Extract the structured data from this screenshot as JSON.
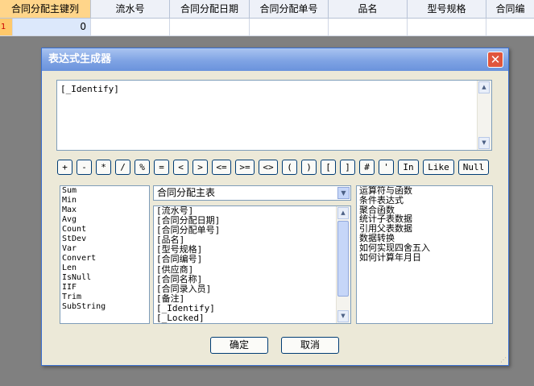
{
  "grid": {
    "headers": [
      "合同分配主键列",
      "流水号",
      "合同分配日期",
      "合同分配单号",
      "品名",
      "型号规格",
      "合同编"
    ],
    "row_marker": "1",
    "first_cell_value": "0"
  },
  "dialog": {
    "title": "表达式生成器",
    "close_glyph": "✕",
    "expression": "[_Identify]",
    "operators": [
      "+",
      "-",
      "*",
      "/",
      "%",
      "=",
      "<",
      ">",
      "<=",
      ">=",
      "<>",
      "(",
      ")",
      "[",
      "]",
      "#",
      "'",
      "In",
      "Like",
      "Null"
    ],
    "functions": [
      "Sum",
      "Min",
      "Max",
      "Avg",
      "Count",
      "StDev",
      "Var",
      "Convert",
      "Len",
      "IsNull",
      "IIF",
      "Trim",
      "SubString"
    ],
    "table_select": "合同分配主表",
    "fields": [
      "[流水号]",
      "[合同分配日期]",
      "[合同分配单号]",
      "[品名]",
      "[型号规格]",
      "[合同编号]",
      "[供应商]",
      "[合同名称]",
      "[合同录入员]",
      "[备注]",
      "[_Identify]",
      "[_Locked]"
    ],
    "help_topics": [
      "运算符与函数",
      "条件表达式",
      "聚合函数",
      "统计子表数据",
      "引用父表数据",
      "数据转换",
      "如何实现四舍五入",
      "如何计算年月日"
    ],
    "ok_label": "确定",
    "cancel_label": "取消"
  },
  "colors": {
    "title_gradient_top": "#a9c4f0",
    "title_gradient_bottom": "#6a93dc",
    "dialog_bg": "#ece9d8",
    "active_header": "#ffd58a"
  }
}
